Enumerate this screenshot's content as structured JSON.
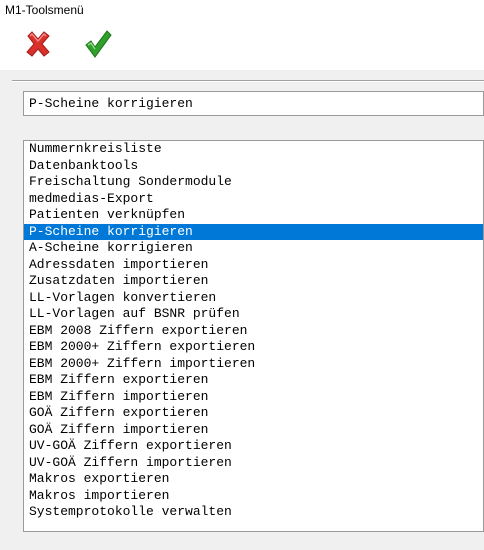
{
  "window": {
    "title": "M1-Toolsmenü"
  },
  "toolbar": {
    "cancel_icon": "red-x-icon",
    "ok_icon": "green-check-icon",
    "cancel_color": "#d9302c",
    "ok_color": "#2fa02a"
  },
  "selected_field": {
    "value": "P-Scheine korrigieren"
  },
  "list": {
    "selected_index": 5,
    "selection_color": "#0078d7",
    "items": [
      {
        "label": "Nummernkreisliste"
      },
      {
        "label": "Datenbanktools"
      },
      {
        "label": "Freischaltung Sondermodule"
      },
      {
        "label": "medmedias-Export"
      },
      {
        "label": "Patienten verknüpfen"
      },
      {
        "label": "P-Scheine korrigieren"
      },
      {
        "label": "A-Scheine korrigieren"
      },
      {
        "label": "Adressdaten importieren"
      },
      {
        "label": "Zusatzdaten importieren"
      },
      {
        "label": "LL-Vorlagen konvertieren"
      },
      {
        "label": "LL-Vorlagen auf BSNR prüfen"
      },
      {
        "label": "EBM 2008 Ziffern exportieren"
      },
      {
        "label": "EBM 2000+ Ziffern exportieren"
      },
      {
        "label": "EBM 2000+ Ziffern importieren"
      },
      {
        "label": "EBM Ziffern exportieren"
      },
      {
        "label": "EBM Ziffern importieren"
      },
      {
        "label": "GOÄ Ziffern exportieren"
      },
      {
        "label": "GOÄ Ziffern importieren"
      },
      {
        "label": "UV-GOÄ Ziffern exportieren"
      },
      {
        "label": "UV-GOÄ Ziffern importieren"
      },
      {
        "label": "Makros exportieren"
      },
      {
        "label": "Makros importieren"
      },
      {
        "label": "Systemprotokolle verwalten"
      }
    ]
  }
}
